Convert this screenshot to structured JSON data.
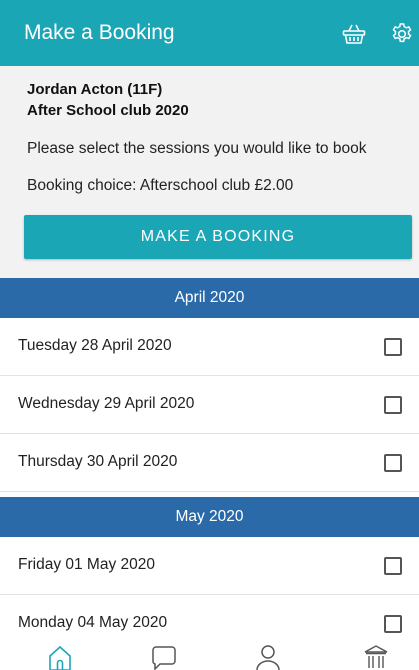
{
  "header": {
    "title": "Make a Booking",
    "basket_icon": "basket-icon",
    "settings_icon": "gear-icon",
    "color": "#1ba6b6"
  },
  "info": {
    "student_name": "Jordan Acton (11F)",
    "club_name": "After School club 2020",
    "instruction": "Please select the sessions you would like to book",
    "booking_choice": "Booking choice: Afterschool club £2.00",
    "button_label": "MAKE A BOOKING"
  },
  "months": [
    {
      "label": "April 2020",
      "sessions": [
        {
          "date": "Tuesday 28 April 2020",
          "checked": false
        },
        {
          "date": "Wednesday 29 April 2020",
          "checked": false
        },
        {
          "date": "Thursday 30 April 2020",
          "checked": false
        }
      ]
    },
    {
      "label": "May 2020",
      "sessions": [
        {
          "date": "Friday 01 May 2020",
          "checked": false
        },
        {
          "date": "Monday 04 May 2020",
          "checked": false
        }
      ]
    }
  ],
  "bottom_nav": [
    {
      "icon": "home-icon",
      "active": true
    },
    {
      "icon": "chat-icon",
      "active": false
    },
    {
      "icon": "user-icon",
      "active": false
    },
    {
      "icon": "bank-icon",
      "active": false
    }
  ],
  "colors": {
    "accent": "#1ba6b6",
    "month_bar": "#2a6aa8"
  }
}
